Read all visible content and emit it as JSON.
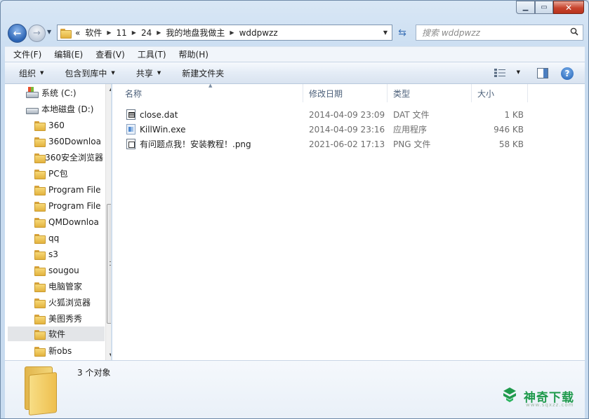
{
  "window": {
    "minimize_glyph": "▁",
    "maximize_glyph": "▭",
    "close_glyph": "✕"
  },
  "navigation": {
    "back_glyph": "←",
    "forward_glyph": "→",
    "recent_glyph": "▼"
  },
  "address_bar": {
    "overflow": "«",
    "crumbs": [
      "软件",
      "11",
      "24",
      "我的地盘我做主",
      "wddpwzz"
    ],
    "separator": "▶",
    "dropdown_glyph": "▼",
    "refresh_glyph": "⇆"
  },
  "search": {
    "placeholder": "搜索 wddpwzz",
    "icon": "magnifier-icon"
  },
  "menu": {
    "items": [
      "文件(F)",
      "编辑(E)",
      "查看(V)",
      "工具(T)",
      "帮助(H)"
    ]
  },
  "command_bar": {
    "organize": "组织",
    "include_in_library": "包含到库中",
    "share": "共享",
    "new_folder": "新建文件夹",
    "dropdown_glyph": "▼",
    "help_glyph": "?"
  },
  "nav_pane": {
    "items": [
      {
        "label": "系统 (C:)",
        "icon": "system-drive-icon"
      },
      {
        "label": "本地磁盘 (D:)",
        "icon": "drive-icon"
      },
      {
        "label": "360",
        "icon": "folder-icon"
      },
      {
        "label": "360Downloa",
        "icon": "folder-icon"
      },
      {
        "label": "360安全浏览器",
        "icon": "folder-icon"
      },
      {
        "label": "PC包",
        "icon": "folder-icon"
      },
      {
        "label": "Program File",
        "icon": "folder-icon"
      },
      {
        "label": "Program File",
        "icon": "folder-icon"
      },
      {
        "label": "QMDownloa",
        "icon": "folder-icon"
      },
      {
        "label": "qq",
        "icon": "folder-icon"
      },
      {
        "label": "s3",
        "icon": "folder-icon"
      },
      {
        "label": "sougou",
        "icon": "folder-icon"
      },
      {
        "label": "电脑管家",
        "icon": "folder-icon"
      },
      {
        "label": "火狐浏览器",
        "icon": "folder-icon"
      },
      {
        "label": "美图秀秀",
        "icon": "folder-icon"
      },
      {
        "label": "软件",
        "icon": "folder-icon",
        "selected": true
      },
      {
        "label": "新obs",
        "icon": "folder-icon"
      }
    ],
    "scroll_up_glyph": "▲",
    "scroll_down_glyph": "▼"
  },
  "file_list": {
    "columns": [
      "名称",
      "修改日期",
      "类型",
      "大小"
    ],
    "sort_glyph": "▲",
    "files": [
      {
        "name": "close.dat",
        "modified": "2014-04-09 23:09",
        "type": "DAT 文件",
        "size": "1 KB",
        "icon": "dat-file-icon"
      },
      {
        "name": "KillWin.exe",
        "modified": "2014-04-09 23:16",
        "type": "应用程序",
        "size": "946 KB",
        "icon": "exe-file-icon"
      },
      {
        "name": "有问题点我！安装教程！.png",
        "modified": "2021-06-02 17:13",
        "type": "PNG 文件",
        "size": "58 KB",
        "icon": "png-file-icon"
      }
    ]
  },
  "details_pane": {
    "item_count": "3 个对象",
    "icon": "large-folder-icon"
  },
  "watermark": {
    "brand": "神奇下载",
    "url": "www.sqxzz.com",
    "brand_color": "#1f9a4c"
  }
}
